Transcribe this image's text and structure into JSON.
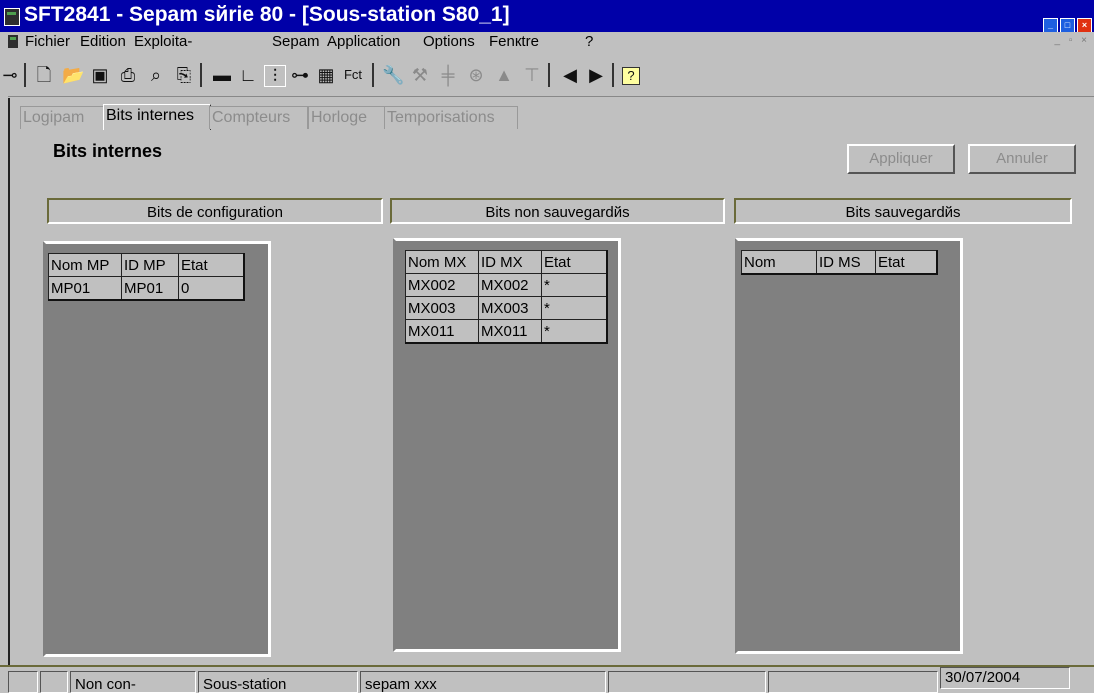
{
  "window": {
    "title": "SFT2841 - Sepam sйrie 80 - [Sous-station S80_1]"
  },
  "menu": {
    "items": [
      "Fichier",
      "Edition",
      "Exploita-",
      "Sepam",
      "Application",
      "Options",
      "Fenкtre",
      "?"
    ]
  },
  "toolbar": {
    "fct_label": "Fct",
    "icons": [
      "connect-icon",
      "new-icon",
      "open-icon",
      "save-icon",
      "print-icon",
      "print-preview-icon",
      "print-setup-icon",
      "sepam-icon",
      "curve-icon",
      "settings-icon",
      "network-icon",
      "grid-icon",
      "fct-icon",
      "wrench-icon",
      "tool2-icon",
      "tool3-icon",
      "tool4-icon",
      "triangle-icon",
      "tool5-icon",
      "prev-icon",
      "next-icon",
      "help-icon"
    ]
  },
  "tabs": [
    {
      "label": "Logipam",
      "active": false
    },
    {
      "label": "Bits internes",
      "active": true
    },
    {
      "label": "Compteurs",
      "active": false
    },
    {
      "label": "Horloge",
      "active": false
    },
    {
      "label": "Temporisations",
      "active": false
    }
  ],
  "panel": {
    "title": "Bits internes",
    "apply_label": "Appliquer",
    "cancel_label": "Annuler"
  },
  "groups": {
    "config": {
      "header": "Bits de configuration",
      "columns": [
        "Nom MP",
        "ID MP",
        "Etat"
      ],
      "rows": [
        [
          "MP01",
          "MP01",
          "0"
        ]
      ]
    },
    "non_saved": {
      "header": "Bits non sauvegardйs",
      "columns": [
        "Nom MX",
        "ID MX",
        "Etat"
      ],
      "rows": [
        [
          "MX002",
          "MX002",
          "*"
        ],
        [
          "MX003",
          "MX003",
          "*"
        ],
        [
          "MX011",
          "MX011",
          "*"
        ]
      ]
    },
    "saved": {
      "header": "Bits sauvegardйs",
      "columns": [
        "Nom",
        "ID MS",
        "Etat"
      ],
      "rows": []
    }
  },
  "status": {
    "connection": "Non con-",
    "station": "Sous-station",
    "device": "sepam xxx",
    "date": "30/07/2004"
  },
  "colors": {
    "title_bg": "#0000a8",
    "panel_bg": "#c0c0c0",
    "list_bg": "#808080"
  }
}
